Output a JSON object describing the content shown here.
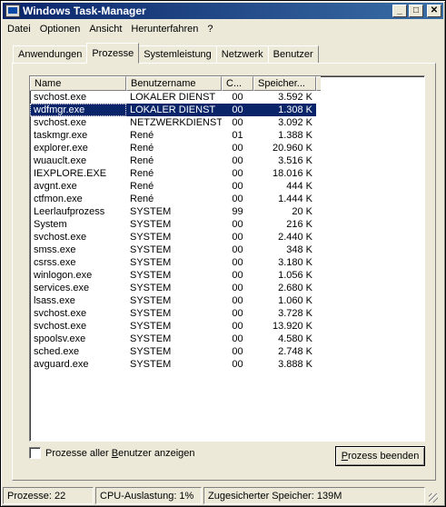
{
  "window": {
    "title": "Windows Task-Manager",
    "buttons": {
      "minimize": "_",
      "maximize": "□",
      "close": "✕"
    }
  },
  "menu": [
    "Datei",
    "Optionen",
    "Ansicht",
    "Herunterfahren",
    "?"
  ],
  "tabs": [
    "Anwendungen",
    "Prozesse",
    "Systemleistung",
    "Netzwerk",
    "Benutzer"
  ],
  "active_tab": "Prozesse",
  "columns": [
    "Name",
    "Benutzername",
    "C...",
    "Speicher..."
  ],
  "processes": [
    {
      "name": "svchost.exe",
      "user": "LOKALER DIENST",
      "cpu": "00",
      "mem": "3.592 K"
    },
    {
      "name": "wdfmgr.exe",
      "user": "LOKALER DIENST",
      "cpu": "00",
      "mem": "1.308 K"
    },
    {
      "name": "svchost.exe",
      "user": "NETZWERKDIENST",
      "cpu": "00",
      "mem": "3.092 K"
    },
    {
      "name": "taskmgr.exe",
      "user": "René",
      "cpu": "01",
      "mem": "1.388 K"
    },
    {
      "name": "explorer.exe",
      "user": "René",
      "cpu": "00",
      "mem": "20.960 K"
    },
    {
      "name": "wuauclt.exe",
      "user": "René",
      "cpu": "00",
      "mem": "3.516 K"
    },
    {
      "name": "IEXPLORE.EXE",
      "user": "René",
      "cpu": "00",
      "mem": "18.016 K"
    },
    {
      "name": "avgnt.exe",
      "user": "René",
      "cpu": "00",
      "mem": "444 K"
    },
    {
      "name": "ctfmon.exe",
      "user": "René",
      "cpu": "00",
      "mem": "1.444 K"
    },
    {
      "name": "Leerlaufprozess",
      "user": "SYSTEM",
      "cpu": "99",
      "mem": "20 K"
    },
    {
      "name": "System",
      "user": "SYSTEM",
      "cpu": "00",
      "mem": "216 K"
    },
    {
      "name": "svchost.exe",
      "user": "SYSTEM",
      "cpu": "00",
      "mem": "2.440 K"
    },
    {
      "name": "smss.exe",
      "user": "SYSTEM",
      "cpu": "00",
      "mem": "348 K"
    },
    {
      "name": "csrss.exe",
      "user": "SYSTEM",
      "cpu": "00",
      "mem": "3.180 K"
    },
    {
      "name": "winlogon.exe",
      "user": "SYSTEM",
      "cpu": "00",
      "mem": "1.056 K"
    },
    {
      "name": "services.exe",
      "user": "SYSTEM",
      "cpu": "00",
      "mem": "2.680 K"
    },
    {
      "name": "lsass.exe",
      "user": "SYSTEM",
      "cpu": "00",
      "mem": "1.060 K"
    },
    {
      "name": "svchost.exe",
      "user": "SYSTEM",
      "cpu": "00",
      "mem": "3.728 K"
    },
    {
      "name": "svchost.exe",
      "user": "SYSTEM",
      "cpu": "00",
      "mem": "13.920 K"
    },
    {
      "name": "spoolsv.exe",
      "user": "SYSTEM",
      "cpu": "00",
      "mem": "4.580 K"
    },
    {
      "name": "sched.exe",
      "user": "SYSTEM",
      "cpu": "00",
      "mem": "2.748 K"
    },
    {
      "name": "avguard.exe",
      "user": "SYSTEM",
      "cpu": "00",
      "mem": "3.888 K"
    }
  ],
  "selected_row": 1,
  "show_all_users": {
    "label_pre": "Prozesse aller ",
    "label_ul": "B",
    "label_post": "enutzer anzeigen",
    "checked": false
  },
  "end_process_button": {
    "label_pre": "",
    "label_ul": "P",
    "label_post": "rozess beenden"
  },
  "statusbar": {
    "processes": "Prozesse: 22",
    "cpu": "CPU-Auslastung: 1%",
    "memory": "Zugesicherter Speicher: 139M"
  },
  "colors": {
    "selection": "#0a246a",
    "titlebar": "#0a246a",
    "face": "#ece9d8"
  }
}
